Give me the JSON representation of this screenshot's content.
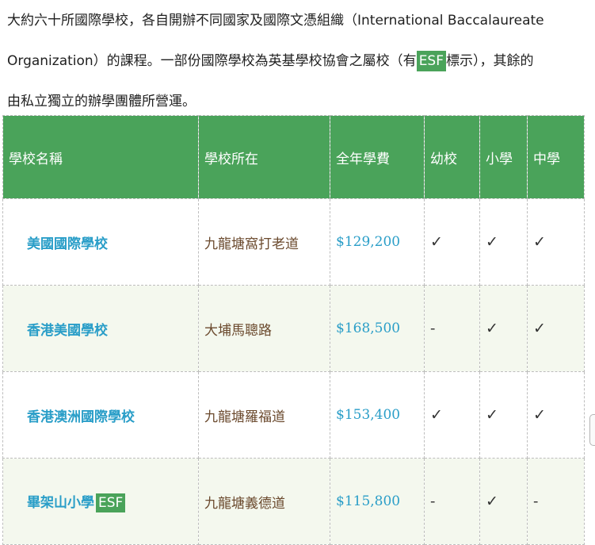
{
  "intro": {
    "line1": "大約六十所國際學校，各自開辦不同國家及國際文憑組織（International Baccalaureate",
    "line2_a": "Organization）的課程。一部份國際學校為英基學校協會之屬校（有",
    "line2_tag": "ESF",
    "line2_b": "標示），其餘的",
    "line3": "由私立獨立的辦學團體所營運。"
  },
  "table": {
    "headers": [
      "學校名稱",
      "學校所在",
      "全年學費",
      "幼校",
      "小學",
      "中學"
    ],
    "rows": [
      {
        "name": "美國國際學校",
        "esf": "",
        "location": "九龍塘窩打老道",
        "fee": "$129,200",
        "kindergarten": "✓",
        "primary": "✓",
        "secondary": "✓"
      },
      {
        "name": "香港美國學校",
        "esf": "",
        "location": "大埔馬聰路",
        "fee": "$168,500",
        "kindergarten": "-",
        "primary": "✓",
        "secondary": "✓"
      },
      {
        "name": "香港澳洲國際學校",
        "esf": "",
        "location": "九龍塘羅福道",
        "fee": "$153,400",
        "kindergarten": "✓",
        "primary": "✓",
        "secondary": "✓"
      },
      {
        "name": "畢架山小學",
        "esf": "ESF",
        "location": "九龍塘義德道",
        "fee": "$115,800",
        "kindergarten": "-",
        "primary": "✓",
        "secondary": "-"
      }
    ]
  },
  "colors": {
    "header_green": "#4aa35a",
    "link_blue": "#2a9ec8",
    "location_brown": "#6b4a2e",
    "alt_row": "#f4f8ee"
  }
}
